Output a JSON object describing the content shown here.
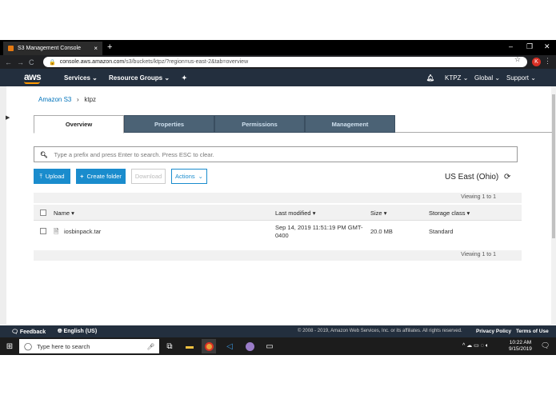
{
  "browser": {
    "tab_title": "S3 Management Console",
    "tab_close": "×",
    "new_tab": "+",
    "url_host": "console.aws.amazon.com",
    "url_path": "/s3/buckets/ktpz/?region=us-east-2&tab=overview",
    "avatar_letter": "K",
    "window_controls": [
      "–",
      "❐",
      "✕"
    ]
  },
  "aws_nav": {
    "logo": "aws",
    "services": "Services",
    "resource_groups": "Resource Groups",
    "account": "KTPZ",
    "region": "Global",
    "support": "Support"
  },
  "breadcrumb": {
    "root": "Amazon S3",
    "separator": "›",
    "bucket": "ktpz"
  },
  "tabs": [
    {
      "label": "Overview",
      "active": true
    },
    {
      "label": "Properties",
      "active": false
    },
    {
      "label": "Permissions",
      "active": false
    },
    {
      "label": "Management",
      "active": false
    }
  ],
  "search": {
    "placeholder": "Type a prefix and press Enter to search. Press ESC to clear."
  },
  "actions": {
    "upload": "Upload",
    "create_folder": "Create folder",
    "download": "Download",
    "actions": "Actions"
  },
  "region_label": "US East (Ohio)",
  "viewing_top": "Viewing 1 to 1",
  "viewing_bottom": "Viewing 1 to 1",
  "table": {
    "columns": [
      "Name",
      "Last modified",
      "Size",
      "Storage class"
    ],
    "rows": [
      {
        "name": "iosbinpack.tar",
        "last_modified_line1": "Sep 14, 2019 11:51:19 PM GMT-",
        "last_modified_line2": "0400",
        "size": "20.0 MB",
        "storage_class": "Standard"
      }
    ]
  },
  "footer": {
    "feedback": "Feedback",
    "language": "English (US)",
    "copyright": "© 2008 - 2019, Amazon Web Services, Inc. or its affiliates. All rights reserved.",
    "privacy": "Privacy Policy",
    "terms": "Terms of Use"
  },
  "taskbar": {
    "search_placeholder": "Type here to search",
    "time": "10:22 AM",
    "date": "9/15/2019"
  },
  "colors": {
    "aws_navy": "#232f3e",
    "aws_orange": "#ff9900",
    "button_blue": "#1a8ccd",
    "tab_slate": "#4b6275"
  }
}
